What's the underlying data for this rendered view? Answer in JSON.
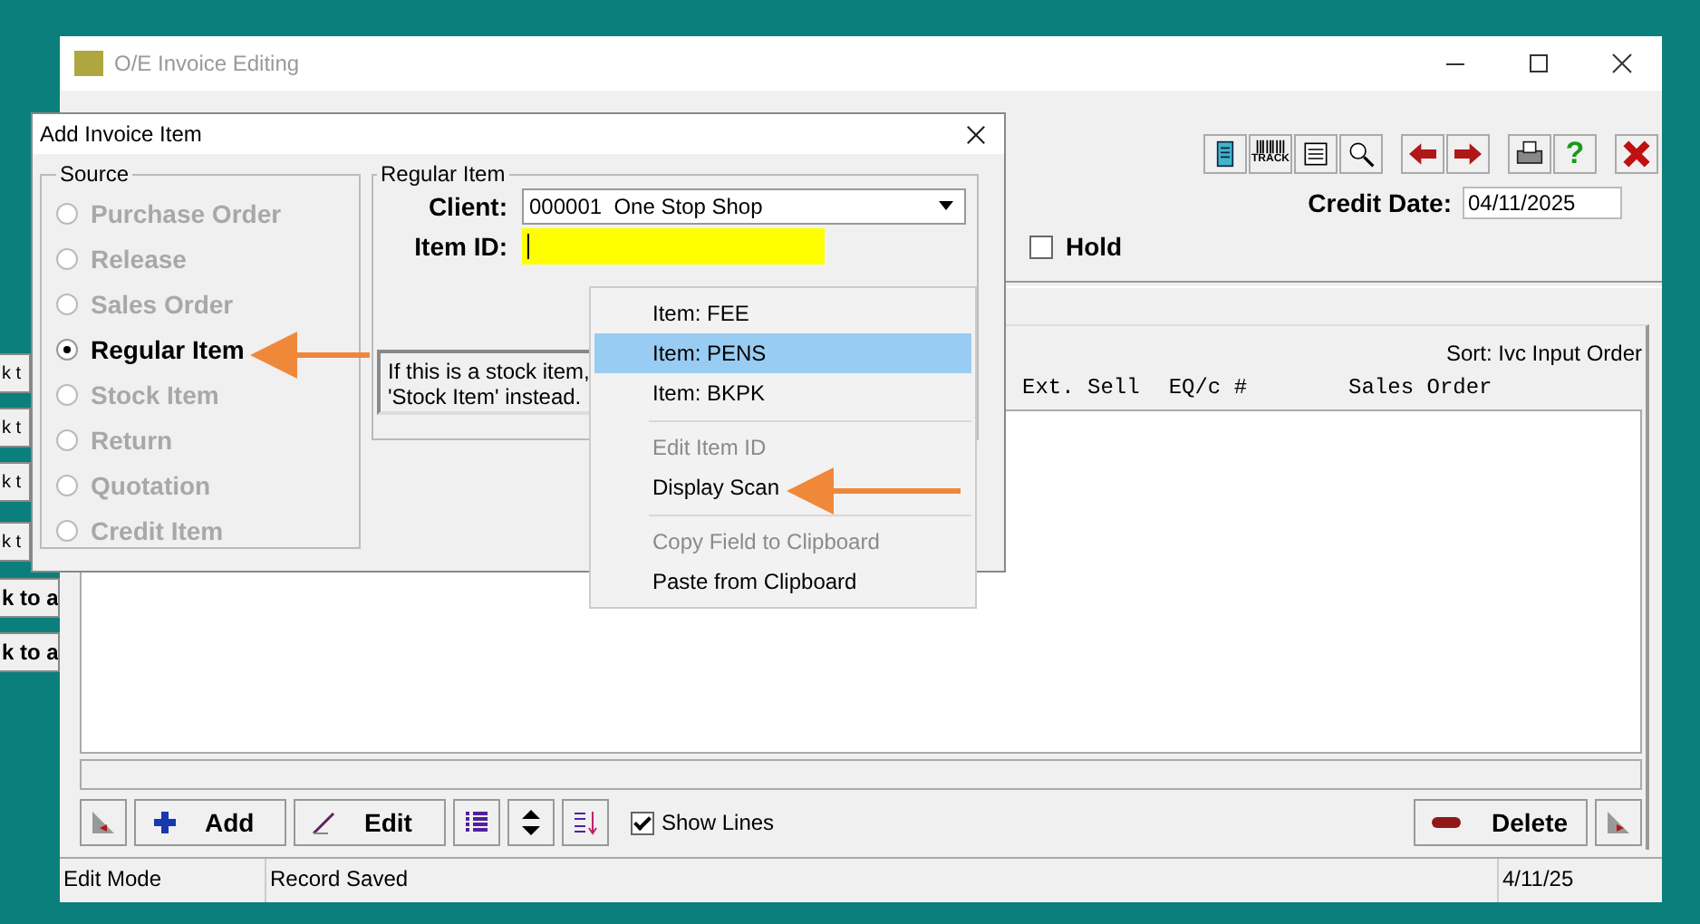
{
  "background_buttons": [
    {
      "label": "k t"
    },
    {
      "label": "k t"
    },
    {
      "label": "k t"
    },
    {
      "label": "k t"
    },
    {
      "label": "k to a"
    },
    {
      "label": "k to a"
    }
  ],
  "window": {
    "title": "O/E Invoice Editing",
    "active": false
  },
  "toolbar": [
    {
      "kind": "book"
    },
    {
      "kind": "track",
      "label": "TRACK"
    },
    {
      "kind": "card"
    },
    {
      "kind": "magnifier"
    },
    {
      "kind": "gap"
    },
    {
      "kind": "left"
    },
    {
      "kind": "right"
    },
    {
      "kind": "gap"
    },
    {
      "kind": "printer"
    },
    {
      "kind": "help",
      "label": "?"
    },
    {
      "kind": "gap"
    },
    {
      "kind": "close"
    }
  ],
  "credit_date": {
    "label": "Credit Date:",
    "value": "04/11/2025"
  },
  "hold": {
    "label": "Hold",
    "checked": false
  },
  "list": {
    "sort": "Sort: Ivc Input Order",
    "columns": [
      "Ext. Sell",
      "EQ/c #",
      "Sales Order"
    ]
  },
  "bottom_buttons": [
    {
      "kind": "exit-left"
    },
    {
      "kind": "add",
      "label": "Add"
    },
    {
      "kind": "edit",
      "label": "Edit"
    },
    {
      "kind": "list"
    },
    {
      "kind": "updown"
    },
    {
      "kind": "sort"
    }
  ],
  "show_lines": {
    "label": "Show Lines",
    "checked": true
  },
  "delete_button": {
    "label": "Delete"
  },
  "status_bar": [
    "Edit Mode",
    "Record Saved",
    "4/11/25"
  ],
  "dialog": {
    "title": "Add Invoice Item",
    "source": {
      "title": "Source",
      "options": [
        {
          "label": "Purchase Order",
          "selected": false,
          "disabled": true
        },
        {
          "label": "Release",
          "selected": false,
          "disabled": true
        },
        {
          "label": "Sales Order",
          "selected": false,
          "disabled": true
        },
        {
          "label": "Regular Item",
          "selected": true,
          "disabled": false
        },
        {
          "label": "Stock Item",
          "selected": false,
          "disabled": true
        },
        {
          "label": "Return",
          "selected": false,
          "disabled": true
        },
        {
          "label": "Quotation",
          "selected": false,
          "disabled": true
        },
        {
          "label": "Credit Item",
          "selected": false,
          "disabled": true
        }
      ]
    },
    "regular": {
      "title": "Regular Item",
      "client_label": "Client:",
      "client_value": "000001  One Stop Shop",
      "item_label": "Item ID:",
      "info": [
        "If this is a stock item,",
        "'Stock Item' instead."
      ]
    }
  },
  "context_menu": [
    {
      "kind": "item",
      "label": "Item: FEE",
      "selected": false,
      "disabled": false
    },
    {
      "kind": "item",
      "label": "Item: PENS",
      "selected": true,
      "disabled": false
    },
    {
      "kind": "item",
      "label": "Item: BKPK",
      "selected": false,
      "disabled": false
    },
    {
      "kind": "separator"
    },
    {
      "kind": "item",
      "label": "Edit Item ID",
      "selected": false,
      "disabled": true
    },
    {
      "kind": "item",
      "label": "Display Scan",
      "selected": false,
      "disabled": false
    },
    {
      "kind": "separator"
    },
    {
      "kind": "item",
      "label": "Copy Field to Clipboard",
      "selected": false,
      "disabled": true
    },
    {
      "kind": "item",
      "label": "Paste from Clipboard",
      "selected": false,
      "disabled": false
    }
  ]
}
